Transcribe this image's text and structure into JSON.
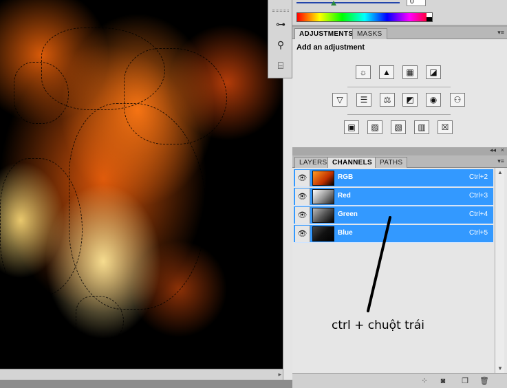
{
  "color_panel": {
    "value": "0",
    "spectrum_icon": "color-spectrum"
  },
  "tools": [
    {
      "icon": "adjust-sliders-icon",
      "glyph": "⊶"
    },
    {
      "icon": "usb-icon",
      "glyph": "⚲"
    },
    {
      "icon": "stamp-icon",
      "glyph": "⌸"
    }
  ],
  "adjustments": {
    "tabs": [
      {
        "label": "ADJUSTMENTS",
        "active": true
      },
      {
        "label": "MASKS",
        "active": false
      }
    ],
    "title": "Add an adjustment",
    "rows": [
      [
        {
          "icon": "brightness-icon",
          "glyph": "☼"
        },
        {
          "icon": "levels-icon",
          "glyph": "▲"
        },
        {
          "icon": "curves-icon",
          "glyph": "▦"
        },
        {
          "icon": "exposure-icon",
          "glyph": "◪"
        }
      ],
      [
        {
          "icon": "vibrance-icon",
          "glyph": "▽"
        },
        {
          "icon": "hue-saturation-icon",
          "glyph": "☰"
        },
        {
          "icon": "color-balance-icon",
          "glyph": "⚖"
        },
        {
          "icon": "black-white-icon",
          "glyph": "◩"
        },
        {
          "icon": "photo-filter-icon",
          "glyph": "◉"
        },
        {
          "icon": "channel-mixer-icon",
          "glyph": "⚇"
        }
      ],
      [
        {
          "icon": "invert-icon",
          "glyph": "▣"
        },
        {
          "icon": "posterize-icon",
          "glyph": "▨"
        },
        {
          "icon": "threshold-icon",
          "glyph": "▧"
        },
        {
          "icon": "gradient-map-icon",
          "glyph": "▥"
        },
        {
          "icon": "selective-color-icon",
          "glyph": "☒"
        }
      ]
    ]
  },
  "channels_panel": {
    "tabs": [
      {
        "label": "LAYERS",
        "active": false
      },
      {
        "label": "CHANNELS",
        "active": true
      },
      {
        "label": "PATHS",
        "active": false
      }
    ],
    "channels": [
      {
        "name": "RGB",
        "shortcut": "Ctrl+2",
        "thumb": "linear-gradient(135deg,#ff9a20,#c03000 60%,#000)"
      },
      {
        "name": "Red",
        "shortcut": "Ctrl+3",
        "thumb": "linear-gradient(135deg,#fff,#999 50%,#222)"
      },
      {
        "name": "Green",
        "shortcut": "Ctrl+4",
        "thumb": "linear-gradient(135deg,#bbb,#555 50%,#000)"
      },
      {
        "name": "Blue",
        "shortcut": "Ctrl+5",
        "thumb": "linear-gradient(135deg,#444,#111 50%,#000)"
      }
    ],
    "annotation": "ctrl + chuột trái",
    "footer_icons": [
      "load-selection-icon",
      "save-selection-icon",
      "new-channel-icon",
      "trash-icon"
    ]
  },
  "colors": {
    "selection": "#3399ff",
    "panel": "#d6d6d6"
  }
}
